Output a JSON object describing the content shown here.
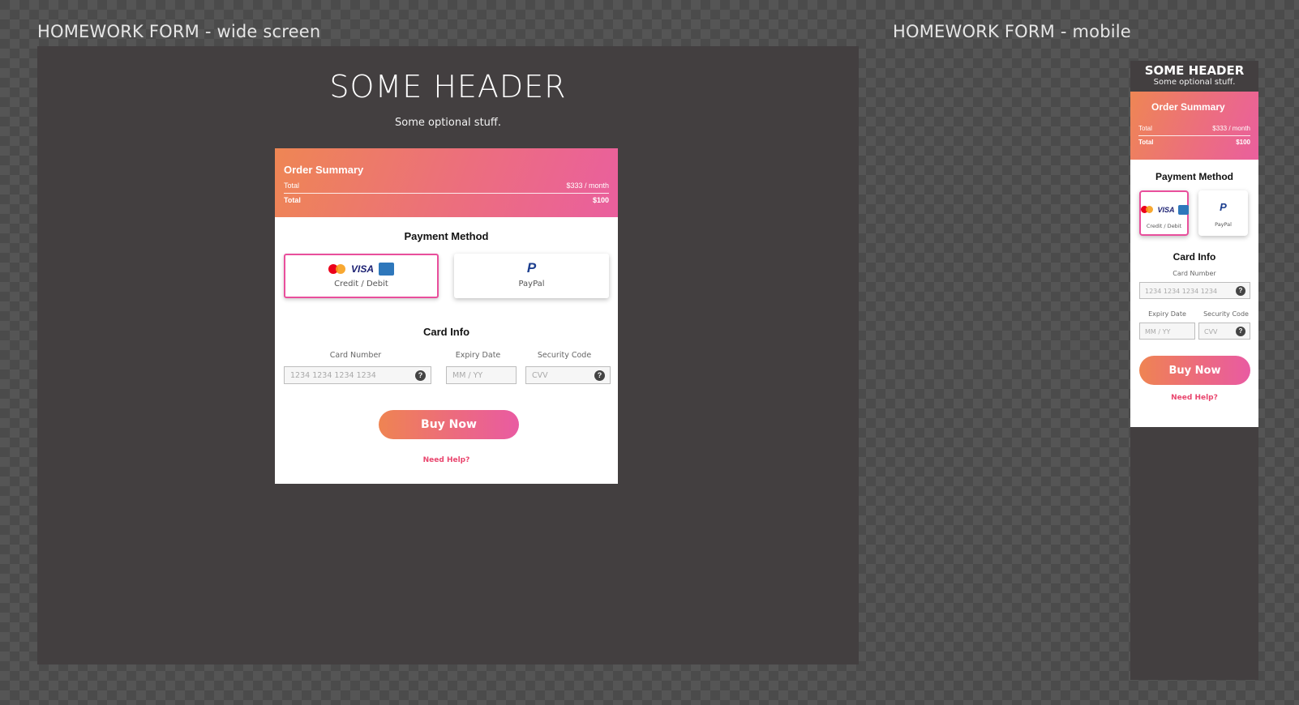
{
  "frames": {
    "wide_label": "HOMEWORK FORM - wide screen",
    "mobile_label": "HOMEWORK FORM - mobile"
  },
  "page": {
    "header": "SOME HEADER",
    "subheader": "Some optional stuff."
  },
  "order_summary": {
    "title": "Order Summary",
    "line_label": "Total",
    "line_value": "$333 / month",
    "total_label": "Total",
    "total_value": "$100"
  },
  "payment": {
    "title": "Payment Method",
    "options": [
      {
        "label": "Credit / Debit",
        "selected": true,
        "icons": [
          "mastercard-icon",
          "visa-icon",
          "amex-icon"
        ]
      },
      {
        "label": "PayPal",
        "selected": false,
        "icons": [
          "paypal-icon"
        ]
      }
    ]
  },
  "card_info": {
    "title": "Card Info",
    "card_number_label": "Card Number",
    "card_number_placeholder": "1234 1234 1234 1234",
    "expiry_label": "Expiry Date",
    "expiry_placeholder": "MM / YY",
    "security_label": "Security Code",
    "security_placeholder": "CVV",
    "help_glyph": "?"
  },
  "actions": {
    "buy_label": "Buy Now",
    "help_link": "Need Help?"
  },
  "colors": {
    "accent_start": "#ef8452",
    "accent_end": "#e95ba2",
    "selected_border": "#e94f9c",
    "link": "#e9466e",
    "frame_bg": "#433f40"
  },
  "brand_text": {
    "visa": "VISA",
    "paypal": "P"
  }
}
